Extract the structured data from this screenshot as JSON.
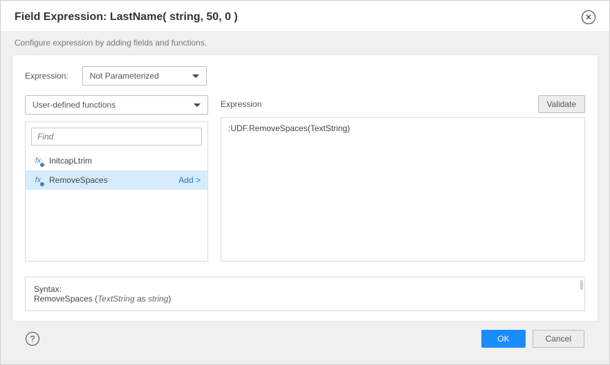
{
  "header": {
    "title": "Field Expression: LastName( string, 50, 0 )"
  },
  "subheader": "Configure expression by adding fields and functions.",
  "expr_type": {
    "label": "Expression:",
    "selected": "Not Parameterized"
  },
  "category_select": {
    "selected": "User-defined functions"
  },
  "search": {
    "placeholder": "Find"
  },
  "functions": [
    {
      "name": "InitcapLtrim",
      "selected": false,
      "add_label": ""
    },
    {
      "name": "RemoveSpaces",
      "selected": true,
      "add_label": "Add >"
    }
  ],
  "right": {
    "label": "Expression",
    "validate": "Validate",
    "content": ":UDF.RemoveSpaces(TextString)"
  },
  "syntax": {
    "label": "Syntax:",
    "fn_name": "RemoveSpaces",
    "open": " (",
    "param": "TextString",
    "as": " as ",
    "type": "string",
    "close": ")"
  },
  "footer": {
    "ok": "OK",
    "cancel": "Cancel"
  }
}
